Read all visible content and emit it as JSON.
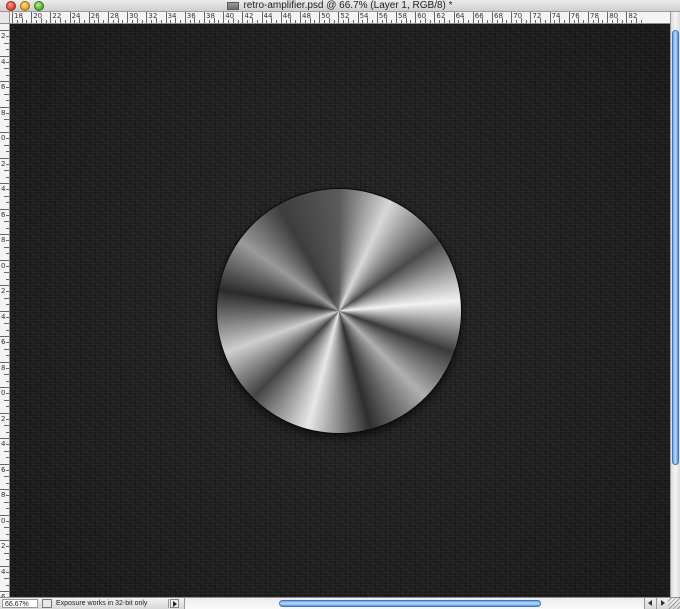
{
  "window": {
    "title": "retro-amplifier.psd @ 66.7% (Layer 1, RGB/8) *"
  },
  "ruler_top": {
    "labels": [
      "18",
      "20",
      "22",
      "24",
      "26",
      "28",
      "30",
      "32",
      "34",
      "36",
      "38",
      "40",
      "42",
      "44",
      "46",
      "48",
      "50",
      "52",
      "54",
      "56",
      "58",
      "60",
      "62",
      "64",
      "66",
      "68",
      "70",
      "72",
      "74",
      "76",
      "78",
      "80",
      "82"
    ]
  },
  "ruler_left": {
    "labels": [
      "2",
      "4",
      "6",
      "8",
      "0",
      "2",
      "4",
      "6",
      "8",
      "0",
      "2",
      "4",
      "6",
      "8",
      "0",
      "2",
      "4",
      "6",
      "8",
      "0",
      "2",
      "4",
      "6"
    ]
  },
  "status": {
    "zoom": "66.67%",
    "message": "Exposure works in 32-bit only"
  },
  "icons": {
    "close": "close-icon",
    "minimize": "minimize-icon",
    "zoom": "zoom-icon",
    "document": "document-icon",
    "status_toggle": "status-toggle-icon",
    "status_arrow": "triangle-right-icon",
    "scroll_left": "arrow-left-icon",
    "scroll_right": "arrow-right-icon"
  },
  "colors": {
    "scroll_thumb": "#6fa6e8",
    "canvas_background": "#1b1b1b"
  }
}
